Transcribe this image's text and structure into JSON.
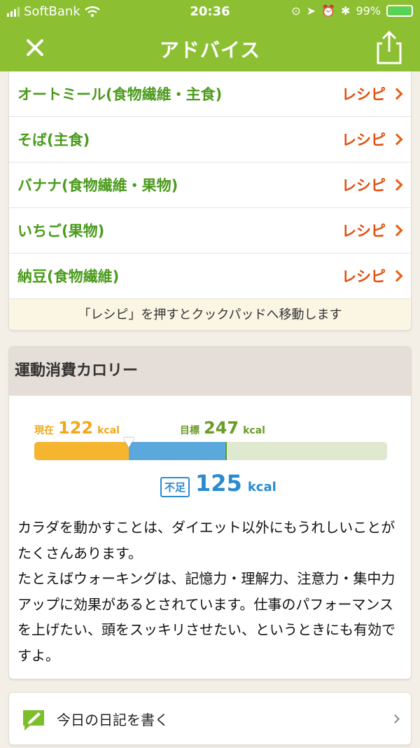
{
  "status_bar": {
    "carrier": "SoftBank",
    "time": "20:36",
    "battery": "99%"
  },
  "header": {
    "title": "アドバイス",
    "close_icon": "close-icon",
    "share_icon": "share-icon"
  },
  "recipes": {
    "items": [
      {
        "name": "オートミール(食物繊維・主食)",
        "link_label": "レシピ"
      },
      {
        "name": "そば(主食)",
        "link_label": "レシピ"
      },
      {
        "name": "バナナ(食物繊維・果物)",
        "link_label": "レシピ"
      },
      {
        "name": "いちご(果物)",
        "link_label": "レシピ"
      },
      {
        "name": "納豆(食物繊維)",
        "link_label": "レシピ"
      }
    ],
    "note": "「レシピ」を押すとクックパッドへ移動します"
  },
  "calorie": {
    "title": "運動消費カロリー",
    "current_label": "現在",
    "current_value": "122",
    "goal_label": "目標",
    "goal_value": "247",
    "unit": "kcal",
    "shortage_label": "不足",
    "shortage_value": "125",
    "bar_max": 455,
    "current": 122,
    "goal": 247,
    "advice": "カラダを動かすことは、ダイエット以外にもうれしいことがたくさんあります。\nたとえばウォーキングは、記憶力・理解力、注意力・集中力アップに効果があるとされています。仕事のパフォーマンスを上げたい、頭をスッキリさせたい、というときにも有効ですよ。"
  },
  "diary": {
    "label": "今日の日記を書く"
  },
  "colors": {
    "header_green": "#8cbf32",
    "item_green": "#4a9b1c",
    "recipe_orange": "#e05010",
    "current_orange": "#f6b531",
    "shortage_blue": "#5aa8dc",
    "goal_green": "#dfe9d0"
  }
}
